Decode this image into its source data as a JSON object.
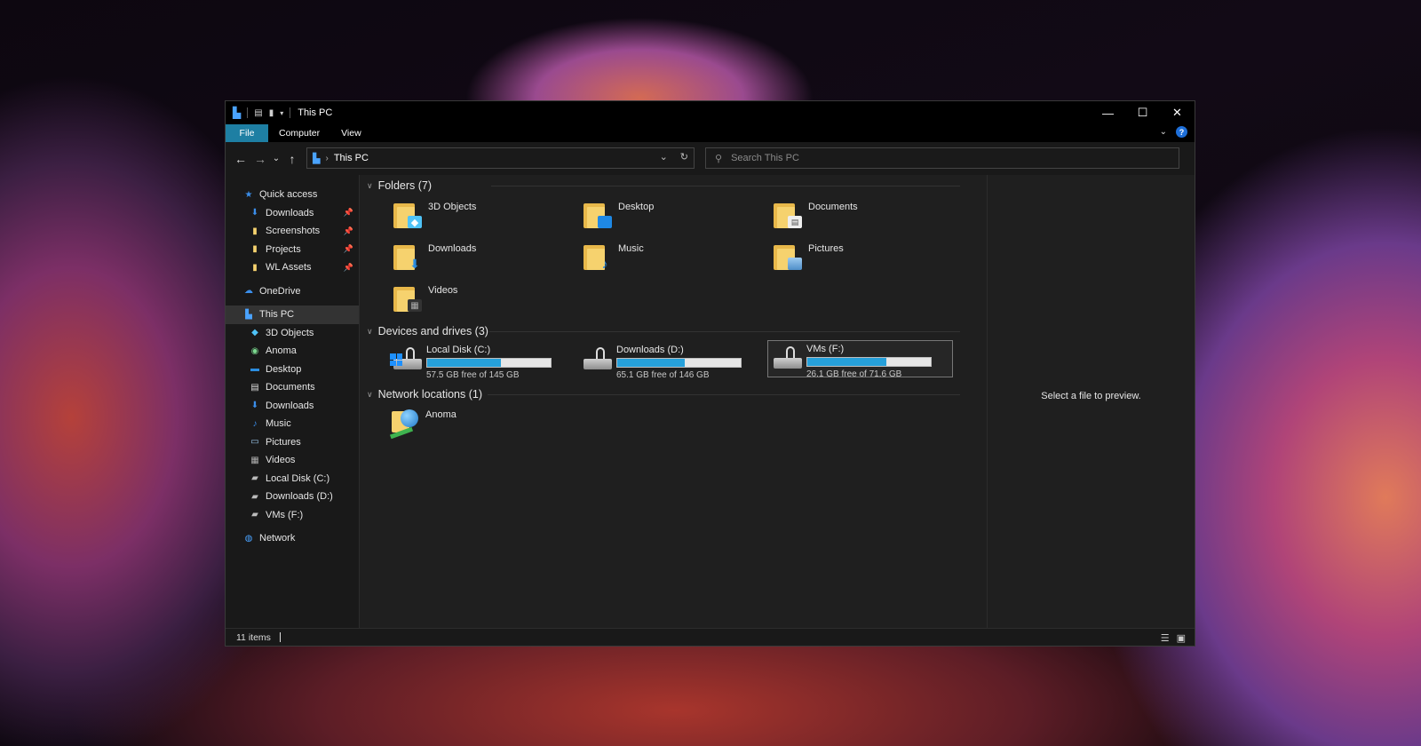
{
  "window": {
    "title": "This PC",
    "controls": {
      "minimize": "—",
      "maximize": "☐",
      "close": "✕"
    }
  },
  "ribbon": {
    "tabs": [
      "File",
      "Computer",
      "View"
    ]
  },
  "nav": {
    "back": "←",
    "forward": "→",
    "recent": "⌄",
    "up": "↑",
    "address": {
      "crumb": "This PC",
      "dropdown": "⌄",
      "refresh": "↻"
    },
    "search": {
      "placeholder": "Search This PC"
    }
  },
  "sidebar": {
    "quick_access": {
      "label": "Quick access",
      "items": [
        {
          "label": "Downloads"
        },
        {
          "label": "Screenshots"
        },
        {
          "label": "Projects"
        },
        {
          "label": "WL Assets"
        }
      ]
    },
    "onedrive": "OneDrive",
    "this_pc": {
      "label": "This PC",
      "items": [
        {
          "label": "3D Objects"
        },
        {
          "label": "Anoma"
        },
        {
          "label": "Desktop"
        },
        {
          "label": "Documents"
        },
        {
          "label": "Downloads"
        },
        {
          "label": "Music"
        },
        {
          "label": "Pictures"
        },
        {
          "label": "Videos"
        },
        {
          "label": "Local Disk (C:)"
        },
        {
          "label": "Downloads (D:)"
        },
        {
          "label": "VMs (F:)"
        }
      ]
    },
    "network": "Network"
  },
  "content": {
    "folders": {
      "header": "Folders (7)",
      "items": [
        {
          "label": "3D Objects"
        },
        {
          "label": "Desktop"
        },
        {
          "label": "Documents"
        },
        {
          "label": "Downloads"
        },
        {
          "label": "Music"
        },
        {
          "label": "Pictures"
        },
        {
          "label": "Videos"
        }
      ]
    },
    "drives": {
      "header": "Devices and drives (3)",
      "items": [
        {
          "name": "Local Disk (C:)",
          "free": "57.5 GB free of 145 GB",
          "used_fraction": 0.6
        },
        {
          "name": "Downloads (D:)",
          "free": "65.1 GB free of 146 GB",
          "used_fraction": 0.55
        },
        {
          "name": "VMs (F:)",
          "free": "26.1 GB free of 71.6 GB",
          "used_fraction": 0.64
        }
      ]
    },
    "network_locations": {
      "header": "Network locations (1)",
      "items": [
        {
          "label": "Anoma"
        }
      ]
    }
  },
  "preview": {
    "text": "Select a file to preview."
  },
  "status": {
    "items": "11 items"
  },
  "colors": {
    "accent": "#1e7fa3",
    "bar_fill": "#26a0da",
    "folder": "#f6d26e"
  }
}
